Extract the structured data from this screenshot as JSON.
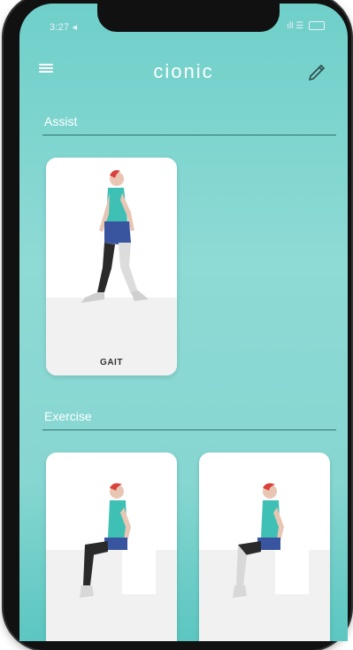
{
  "status_bar": {
    "time": "3:27 ◂",
    "icons": "ıll ☰"
  },
  "header": {
    "logo": "cionic"
  },
  "sections": [
    {
      "title": "Assist",
      "cards": [
        {
          "label": "GAIT"
        }
      ]
    },
    {
      "title": "Exercise",
      "cards": [
        {
          "label": ""
        },
        {
          "label": ""
        }
      ]
    }
  ]
}
